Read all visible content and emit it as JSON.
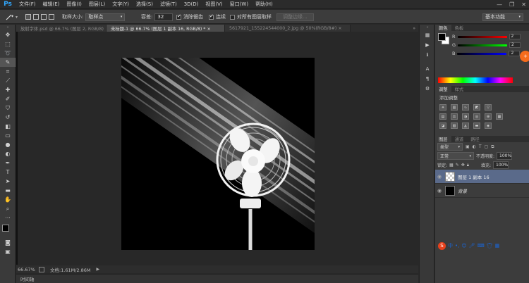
{
  "app": {
    "logo": "Ps"
  },
  "menu": [
    "文件(F)",
    "编辑(E)",
    "图像(I)",
    "图层(L)",
    "文字(Y)",
    "选择(S)",
    "滤镜(T)",
    "3D(D)",
    "视图(V)",
    "窗口(W)",
    "帮助(H)"
  ],
  "window_controls": {
    "minimize": "—",
    "restore": "❐",
    "close": "✕"
  },
  "options": {
    "sample_size_label": "取样大小:",
    "sample_size_value": "取样点",
    "tolerance_label": "容差:",
    "tolerance_value": "32",
    "antialias_label": "消除锯齿",
    "contiguous_label": "连续",
    "all_layers_label": "对所有图层取样",
    "refine_edge_label": "调整边缘...",
    "workspace_value": "基本功能"
  },
  "tabs": [
    "放射字体.psd @ 66.7% (图层 2, RGB/8) ×",
    "未标题-1 @ 66.7% (图层 1 副本 16, RGB/8) * ×",
    "5617921_155224544000_2.jpg @ 50%(RGB/8#) ×"
  ],
  "status": {
    "zoom": "66.67%",
    "doc_info": "文档:1.61M/2.86M",
    "arrow": "▶"
  },
  "timeline": {
    "label": "时间轴"
  },
  "color_panel": {
    "tabs": [
      "颜色",
      "色板"
    ],
    "rows": [
      {
        "label": "R",
        "value": "2"
      },
      {
        "label": "G",
        "value": "2"
      },
      {
        "label": "B",
        "value": "2"
      }
    ]
  },
  "adjust_panel": {
    "tabs": [
      "调整",
      "样式"
    ],
    "title": "添加调整"
  },
  "layers_panel": {
    "tabs": [
      "图层",
      "通道",
      "路径"
    ],
    "filter_value": "类型",
    "blend_mode": "正常",
    "opacity_label": "不透明度:",
    "opacity_value": "100%",
    "lock_label": "锁定:",
    "fill_label": "填充:",
    "fill_value": "100%",
    "layers": [
      {
        "name": "图层 1 副本 16"
      },
      {
        "name": "背景"
      }
    ]
  },
  "ime": {
    "lang": "中",
    "punct": "•,"
  }
}
